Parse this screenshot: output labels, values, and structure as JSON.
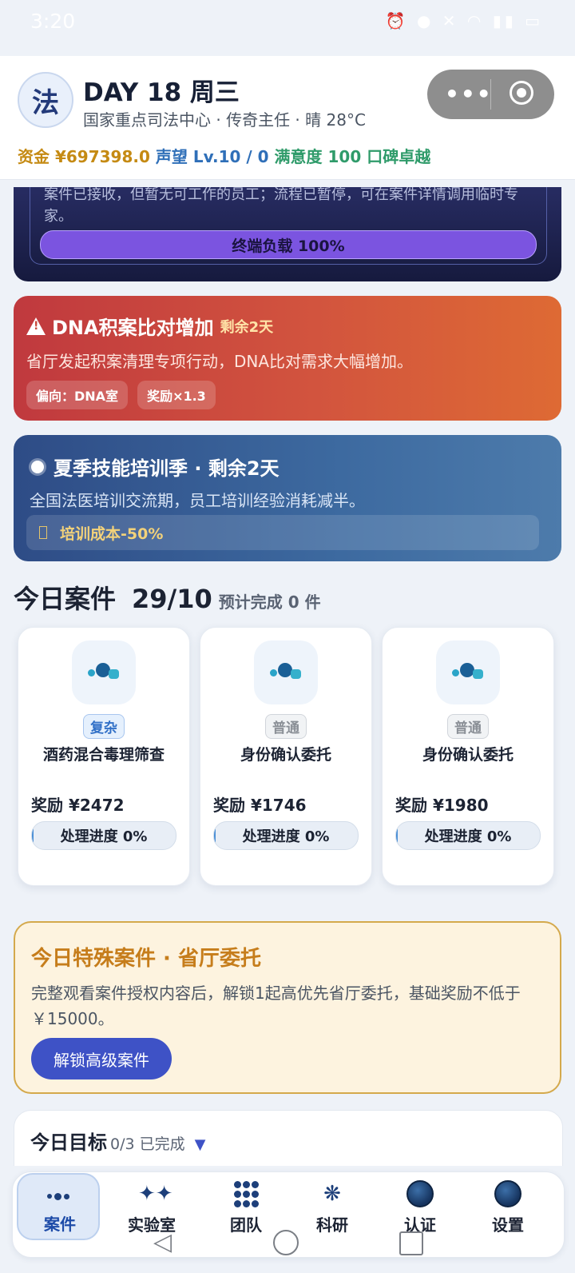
{
  "status_bar": {
    "time": "3:20",
    "icons": [
      "alarm-icon",
      "location-icon",
      "mute-icon",
      "wifi-icon",
      "signal-icon",
      "battery-icon"
    ],
    "battery": "100"
  },
  "header": {
    "avatar_char": "法",
    "day_title": "DAY 18  周三",
    "subtitle": "国家重点司法中心 · 传奇主任 · 晴 28°C",
    "funds": "资金 ¥697398.0",
    "reputation": "声望 Lv.10 / 0",
    "satisfaction": "满意度 100 口碑卓越"
  },
  "terminal_card": {
    "message": "案件已接收，但暂无可工作的员工；流程已暂停，可在案件详情调用临时专家。",
    "load_label": "终端负载 100%",
    "load_value": 100
  },
  "event_dna": {
    "title": "DNA积案比对增加",
    "remaining": "剩余2天",
    "description": "省厅发起积案清理专项行动，DNA比对需求大幅增加。",
    "tags": [
      "偏向：DNA室",
      "奖励×1.3"
    ]
  },
  "event_summer": {
    "title": "夏季技能培训季 · 剩余2天",
    "description": "全国法医培训交流期，员工培训经验消耗减半。",
    "perk": "培训成本-50%"
  },
  "today_cases": {
    "title": "今日案件",
    "count": "29/10",
    "expected": "预计完成 0 件",
    "cards": [
      {
        "badge": "复杂",
        "badge_type": "complex",
        "name": "酒药混合毒理筛查",
        "reward": "奖励  ¥2472",
        "progress_label": "处理进度 0%",
        "progress": 0
      },
      {
        "badge": "普通",
        "badge_type": "normal",
        "name": "身份确认委托",
        "reward": "奖励  ¥1746",
        "progress_label": "处理进度 0%",
        "progress": 0
      },
      {
        "badge": "普通",
        "badge_type": "normal",
        "name": "身份确认委托",
        "reward": "奖励  ¥1980",
        "progress_label": "处理进度 0%",
        "progress": 0
      }
    ]
  },
  "special_case": {
    "title": "今日特殊案件 · 省厅委托",
    "description": "完整观看案件授权内容后，解锁1起高优先省厅委托，基础奖励不低于￥15000。",
    "button": "解锁高级案件"
  },
  "goals": {
    "title": "今日目标",
    "status": "0/3 已完成",
    "caret": "▼"
  },
  "tabbar": {
    "tabs": [
      {
        "label": "案件",
        "icon": "molecule-icon",
        "active": true
      },
      {
        "label": "实验室",
        "icon": "lab-icon",
        "active": false
      },
      {
        "label": "团队",
        "icon": "team-icon",
        "active": false
      },
      {
        "label": "科研",
        "icon": "research-icon",
        "active": false
      },
      {
        "label": "认证",
        "icon": "certification-icon",
        "active": false
      },
      {
        "label": "设置",
        "icon": "settings-icon",
        "active": false
      }
    ]
  },
  "colors": {
    "accent": "#3e52c6",
    "gold": "#c58a13",
    "blue": "#2f6fb8",
    "green": "#2f9b6a",
    "warning_red": "#c0393e",
    "special_orange": "#c67d1b"
  }
}
